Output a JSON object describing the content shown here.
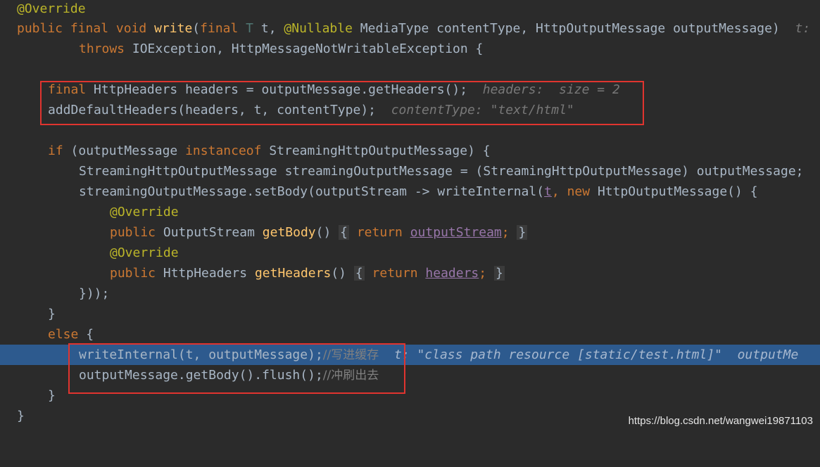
{
  "code": {
    "l1_annotation": "@Override",
    "l2_public": "public",
    "l2_final": "final",
    "l2_void": "void",
    "l2_method": "write",
    "l2_open": "(",
    "l2_final2": "final",
    "l2_typeparam": "T",
    "l2_t": "t,",
    "l2_nullable": "@Nullable",
    "l2_rest": "MediaType contentType, HttpOutputMessage outputMessage)",
    "l2_hint": "t:",
    "l3_throws": "throws",
    "l3_rest": "IOException, HttpMessageNotWritableException {",
    "l5_final": "final",
    "l5_code": "HttpHeaders headers = outputMessage.getHeaders();",
    "l5_hint": "headers:  size = 2",
    "l6_code": "addDefaultHeaders(headers, t, contentType);",
    "l6_hint": "contentType: \"text/html\"",
    "l8_if": "if",
    "l8_open": "(outputMessage",
    "l8_instanceof": "instanceof",
    "l8_rest": "StreamingHttpOutputMessage) {",
    "l9_code": "StreamingHttpOutputMessage streamingOutputMessage = (StreamingHttpOutputMessage) outputMessage;",
    "l10_a": "streamingOutputMessage.setBody(outputStream -> writeInternal(",
    "l10_t": "t",
    "l10_comma": ",",
    "l10_new": "new",
    "l10_rest": "HttpOutputMessage() {",
    "l11_annotation": "@Override",
    "l12_public": "public",
    "l12_type": "OutputStream",
    "l12_method": "getBody",
    "l12_parens": "()",
    "l12_fold_open": "{",
    "l12_return": "return",
    "l12_field": "outputStream",
    "l12_semi": ";",
    "l12_fold_close": "}",
    "l13_annotation": "@Override",
    "l14_public": "public",
    "l14_type": "HttpHeaders",
    "l14_method": "getHeaders",
    "l14_parens": "()",
    "l14_fold_open": "{",
    "l14_return": "return",
    "l14_field": "headers",
    "l14_semi": ";",
    "l14_fold_close": "}",
    "l15_code": "}));",
    "l16_code": "}",
    "l17_else": "else",
    "l17_brace": "{",
    "l18_code": "writeInternal(t, outputMessage);",
    "l18_comment": "//写进缓存",
    "l18_hint": "t: \"class path resource [static/test.html]\"  outputMe",
    "l19_code": "outputMessage.getBody().flush();",
    "l19_comment": "//冲刷出去",
    "l20_code": "}",
    "l21_code": "}"
  },
  "watermark": "https://blog.csdn.net/wangwei19871103",
  "colors": {
    "background": "#2b2b2b",
    "highlight_line": "#2d5a8e",
    "keyword": "#cc7832",
    "annotation": "#bbb529",
    "method": "#ffc66d",
    "field": "#9876aa",
    "box": "#e0342f"
  }
}
